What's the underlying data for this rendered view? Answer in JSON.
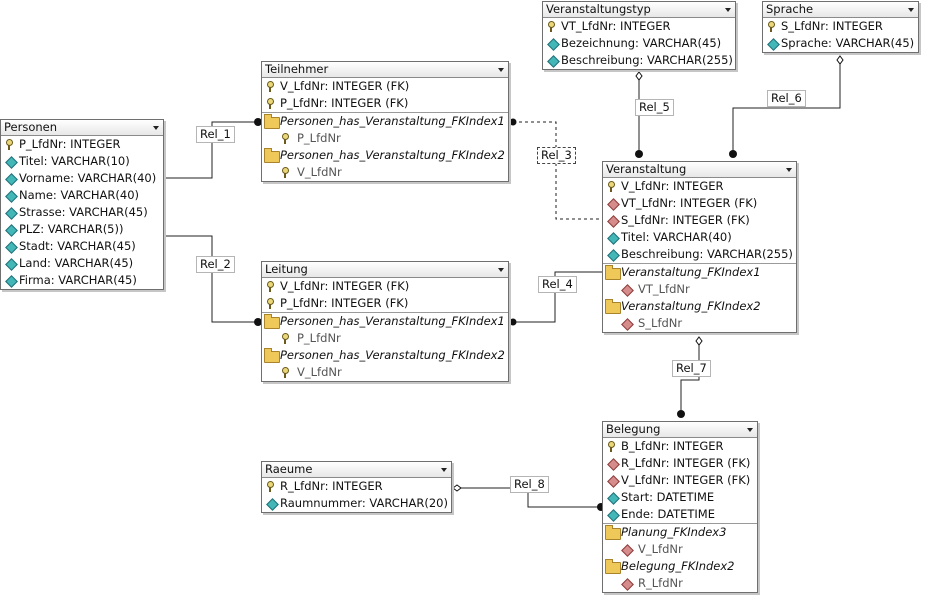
{
  "tables": {
    "personen": {
      "title": "Personen",
      "rows": [
        "P_LfdNr: INTEGER",
        "Titel: VARCHAR(10)",
        "Vorname: VARCHAR(40)",
        "Name: VARCHAR(40)",
        "Strasse: VARCHAR(45)",
        "PLZ: VARCHAR(5))",
        "Stadt: VARCHAR(45)",
        "Land: VARCHAR(45)",
        "Firma: VARCHAR(45)"
      ]
    },
    "teilnehmer": {
      "title": "Teilnehmer",
      "rows": [
        "V_LfdNr: INTEGER (FK)",
        "P_LfdNr: INTEGER (FK)",
        "Personen_has_Veranstaltung_FKIndex1",
        "P_LfdNr",
        "Personen_has_Veranstaltung_FKIndex2",
        "V_LfdNr"
      ]
    },
    "leitung": {
      "title": "Leitung",
      "rows": [
        "V_LfdNr: INTEGER (FK)",
        "P_LfdNr: INTEGER (FK)",
        "Personen_has_Veranstaltung_FKIndex1",
        "P_LfdNr",
        "Personen_has_Veranstaltung_FKIndex2",
        "V_LfdNr"
      ]
    },
    "veranstaltungstyp": {
      "title": "Veranstaltungstyp",
      "rows": [
        "VT_LfdNr: INTEGER",
        "Bezeichnung: VARCHAR(45)",
        "Beschreibung: VARCHAR(255)"
      ]
    },
    "sprache": {
      "title": "Sprache",
      "rows": [
        "S_LfdNr: INTEGER",
        "Sprache: VARCHAR(45)"
      ]
    },
    "veranstaltung": {
      "title": "Veranstaltung",
      "rows": [
        "V_LfdNr: INTEGER",
        "VT_LfdNr: INTEGER (FK)",
        "S_LfdNr: INTEGER (FK)",
        "Titel: VARCHAR(40)",
        "Beschreibung: VARCHAR(255)",
        "Veranstaltung_FKIndex1",
        "VT_LfdNr",
        "Veranstaltung_FKIndex2",
        "S_LfdNr"
      ]
    },
    "belegung": {
      "title": "Belegung",
      "rows": [
        "B_LfdNr: INTEGER",
        "R_LfdNr: INTEGER (FK)",
        "V_LfdNr: INTEGER (FK)",
        "Start: DATETIME",
        "Ende: DATETIME",
        "Planung_FKIndex3",
        "V_LfdNr",
        "Belegung_FKIndex2",
        "R_LfdNr"
      ]
    },
    "raeume": {
      "title": "Raeume",
      "rows": [
        "R_LfdNr: INTEGER",
        "Raumnummer: VARCHAR(20)"
      ]
    }
  },
  "relations": [
    "Rel_1",
    "Rel_2",
    "Rel_3",
    "Rel_4",
    "Rel_5",
    "Rel_6",
    "Rel_7",
    "Rel_8"
  ]
}
